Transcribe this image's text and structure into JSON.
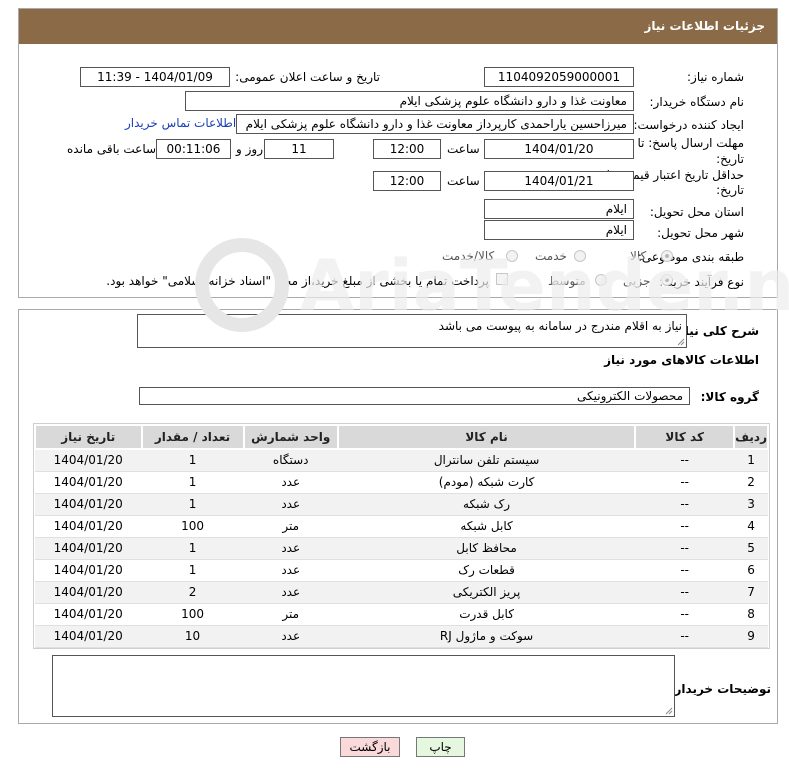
{
  "header": {
    "title": "جزئیات اطلاعات نیاز"
  },
  "fields": {
    "need_number_label": "شماره نیاز:",
    "need_number": "1104092059000001",
    "announce_label": "تاریخ و ساعت اعلان عمومی:",
    "announce_value": "1404/01/09 - 11:39",
    "buyer_org_label": "نام دستگاه خریدار:",
    "buyer_org": "معاونت غذا و دارو دانشگاه علوم پزشکی ایلام",
    "creator_label": "ایجاد کننده درخواست:",
    "creator": "میرزاحسین یاراحمدی کارپرداز معاونت غذا و دارو دانشگاه علوم پزشکی ایلام",
    "contact_link": "اطلاعات تماس خریدار",
    "deadline_label_1": "مهلت ارسال پاسخ: تا",
    "deadline_label_2": "تاریخ:",
    "deadline_date": "1404/01/20",
    "time_label": "ساعت",
    "deadline_time": "12:00",
    "days_value": "11",
    "days_label": "روز و",
    "remaining_value": "00:11:06",
    "remaining_label": "ساعت باقی مانده",
    "validity_label_1": "حداقل تاریخ اعتبار قیمت: تا",
    "validity_label_2": "تاریخ:",
    "validity_date": "1404/01/21",
    "validity_time": "12:00",
    "province_label": "استان محل تحویل:",
    "province": "ایلام",
    "city_label": "شهر محل تحویل:",
    "city": "ایلام",
    "category_label": "طبقه بندی موضوعی:",
    "category_options": [
      "کالا",
      "خدمت",
      "کالا/خدمت"
    ],
    "process_label": "نوع فرآیند خرید :",
    "process_options": [
      "جزیی",
      "متوسط"
    ],
    "payment_note": "پرداخت تمام یا بخشی از مبلغ خرید،از محل \"اسناد خزانه اسلامی\" خواهد بود."
  },
  "description": {
    "label": "شرح کلی نیاز:",
    "text": "نیاز به اقلام مندرج در سامانه به پیوست می باشد"
  },
  "goods": {
    "section_title": "اطلاعات کالاهای مورد نیاز",
    "group_label": "گروه کالا:",
    "group_value": "محصولات الکترونیکی",
    "columns": [
      "ردیف",
      "کد کالا",
      "نام کالا",
      "واحد شمارش",
      "تعداد / مقدار",
      "تاریخ نیاز"
    ],
    "rows": [
      [
        "1",
        "--",
        "سیستم تلفن سانترال",
        "دستگاه",
        "1",
        "1404/01/20"
      ],
      [
        "2",
        "--",
        "کارت شبکه (مودم)",
        "عدد",
        "1",
        "1404/01/20"
      ],
      [
        "3",
        "--",
        "رک شبکه",
        "عدد",
        "1",
        "1404/01/20"
      ],
      [
        "4",
        "--",
        "کابل شبکه",
        "متر",
        "100",
        "1404/01/20"
      ],
      [
        "5",
        "--",
        "محافظ کابل",
        "عدد",
        "1",
        "1404/01/20"
      ],
      [
        "6",
        "--",
        "قطعات رک",
        "عدد",
        "1",
        "1404/01/20"
      ],
      [
        "7",
        "--",
        "پریز الکتریکی",
        "عدد",
        "2",
        "1404/01/20"
      ],
      [
        "8",
        "--",
        "کابل قدرت",
        "متر",
        "100",
        "1404/01/20"
      ],
      [
        "9",
        "--",
        "سوکت و ماژول RJ",
        "عدد",
        "10",
        "1404/01/20"
      ]
    ]
  },
  "buyer_notes": {
    "label": "توضیحات خریدار:",
    "text": ""
  },
  "buttons": {
    "print": "چاپ",
    "back": "بازگشت"
  },
  "watermark": {
    "text": "AriaTender.neT"
  },
  "colors": {
    "header_bg": "#8b6b47",
    "link": "#1a3fb8",
    "back_btn_bg": "#f9d9d9",
    "print_btn_bg": "#e6f7e0"
  }
}
